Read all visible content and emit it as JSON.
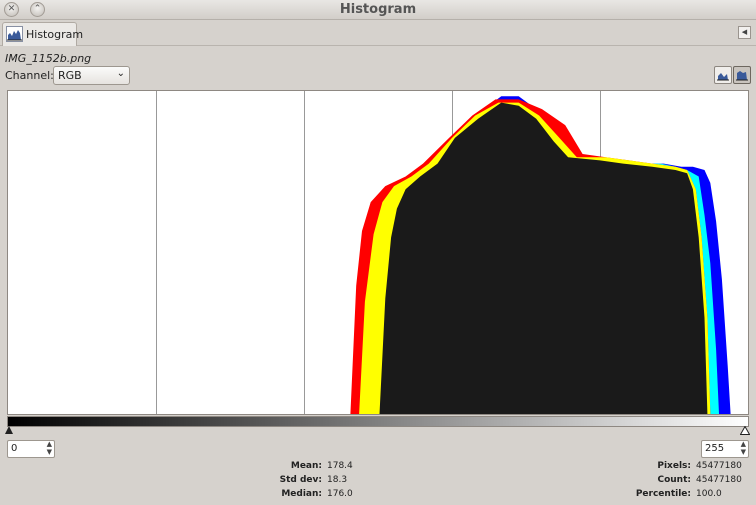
{
  "window": {
    "title": "Histogram"
  },
  "tab": {
    "label": "Histogram",
    "icon": "histogram-icon"
  },
  "image_name": "IMG_1152b.png",
  "channel": {
    "label": "Channel:",
    "selected": "RGB"
  },
  "range": {
    "low": "0",
    "high": "255"
  },
  "stats": {
    "mean_label": "Mean:",
    "mean": "178.4",
    "stddev_label": "Std dev:",
    "stddev": "18.3",
    "median_label": "Median:",
    "median": "176.0",
    "pixels_label": "Pixels:",
    "pixels": "45477180",
    "count_label": "Count:",
    "count": "45477180",
    "percentile_label": "Percentile:",
    "percentile": "100.0"
  },
  "colors": {
    "red": "#ff0000",
    "yellow": "#ffff00",
    "green": "#00ff00",
    "cyan": "#00ffff",
    "blue": "#0000ff",
    "magenta": "#ff00ff",
    "gray": "#1a1a1a"
  },
  "chart_data": {
    "type": "area",
    "xlim": [
      0,
      255
    ],
    "ylim": [
      0,
      1
    ],
    "gridlines_x": [
      51,
      102,
      153,
      204
    ],
    "series": [
      {
        "key": "blue",
        "color": "#0000ff",
        "points": [
          [
            138,
            0
          ],
          [
            141,
            0.41
          ],
          [
            143,
            0.63
          ],
          [
            146,
            0.7
          ],
          [
            149,
            0.74
          ],
          [
            152,
            0.77
          ],
          [
            158,
            0.89
          ],
          [
            164,
            0.95
          ],
          [
            170,
            0.99
          ],
          [
            176,
            0.99
          ],
          [
            182,
            0.95
          ],
          [
            188,
            0.83
          ],
          [
            194,
            0.79
          ],
          [
            206,
            0.79
          ],
          [
            218,
            0.78
          ],
          [
            226,
            0.78
          ],
          [
            232,
            0.77
          ],
          [
            236,
            0.77
          ],
          [
            240,
            0.76
          ],
          [
            242,
            0.72
          ],
          [
            244,
            0.6
          ],
          [
            246,
            0.42
          ],
          [
            248,
            0.15
          ],
          [
            249,
            0
          ]
        ]
      },
      {
        "key": "cyan",
        "color": "#00ffff",
        "points": [
          [
            137,
            0
          ],
          [
            140,
            0.41
          ],
          [
            142,
            0.63
          ],
          [
            145,
            0.7
          ],
          [
            148,
            0.74
          ],
          [
            151,
            0.77
          ],
          [
            157,
            0.88
          ],
          [
            163,
            0.94
          ],
          [
            169,
            0.98
          ],
          [
            175,
            0.97
          ],
          [
            181,
            0.93
          ],
          [
            187,
            0.82
          ],
          [
            193,
            0.79
          ],
          [
            205,
            0.79
          ],
          [
            217,
            0.78
          ],
          [
            225,
            0.78
          ],
          [
            230,
            0.77
          ],
          [
            234,
            0.76
          ],
          [
            238,
            0.74
          ],
          [
            240,
            0.62
          ],
          [
            242,
            0.47
          ],
          [
            244,
            0.2
          ],
          [
            245,
            0
          ]
        ]
      },
      {
        "key": "red",
        "color": "#ff0000",
        "points": [
          [
            118,
            0
          ],
          [
            120,
            0.4
          ],
          [
            122,
            0.57
          ],
          [
            125,
            0.66
          ],
          [
            130,
            0.71
          ],
          [
            137,
            0.74
          ],
          [
            143,
            0.78
          ],
          [
            152,
            0.86
          ],
          [
            160,
            0.93
          ],
          [
            168,
            0.98
          ],
          [
            176,
            0.98
          ],
          [
            184,
            0.95
          ],
          [
            192,
            0.9
          ],
          [
            198,
            0.81
          ],
          [
            206,
            0.8
          ],
          [
            214,
            0.79
          ],
          [
            222,
            0.78
          ],
          [
            230,
            0.77
          ],
          [
            234,
            0.76
          ],
          [
            237,
            0.7
          ],
          [
            239,
            0.55
          ],
          [
            241,
            0.3
          ],
          [
            242,
            0
          ]
        ]
      },
      {
        "key": "yellow",
        "color": "#ffff00",
        "points": [
          [
            121,
            0
          ],
          [
            123,
            0.35
          ],
          [
            126,
            0.56
          ],
          [
            129,
            0.66
          ],
          [
            133,
            0.71
          ],
          [
            139,
            0.74
          ],
          [
            145,
            0.78
          ],
          [
            153,
            0.86
          ],
          [
            161,
            0.93
          ],
          [
            169,
            0.97
          ],
          [
            176,
            0.97
          ],
          [
            183,
            0.93
          ],
          [
            190,
            0.86
          ],
          [
            196,
            0.8
          ],
          [
            206,
            0.8
          ],
          [
            214,
            0.79
          ],
          [
            222,
            0.78
          ],
          [
            230,
            0.77
          ],
          [
            234,
            0.76
          ],
          [
            237,
            0.7
          ],
          [
            239,
            0.55
          ],
          [
            241,
            0.3
          ],
          [
            242,
            0
          ]
        ]
      },
      {
        "key": "gray",
        "color": "#1a1a1a",
        "points": [
          [
            128,
            0
          ],
          [
            130,
            0.36
          ],
          [
            132,
            0.55
          ],
          [
            134,
            0.64
          ],
          [
            137,
            0.7
          ],
          [
            142,
            0.74
          ],
          [
            148,
            0.78
          ],
          [
            154,
            0.86
          ],
          [
            162,
            0.92
          ],
          [
            170,
            0.97
          ],
          [
            176,
            0.96
          ],
          [
            182,
            0.92
          ],
          [
            188,
            0.85
          ],
          [
            193,
            0.8
          ],
          [
            204,
            0.79
          ],
          [
            212,
            0.78
          ],
          [
            222,
            0.77
          ],
          [
            230,
            0.76
          ],
          [
            234,
            0.75
          ],
          [
            236,
            0.7
          ],
          [
            238,
            0.55
          ],
          [
            240,
            0.3
          ],
          [
            241,
            0
          ]
        ]
      }
    ]
  }
}
